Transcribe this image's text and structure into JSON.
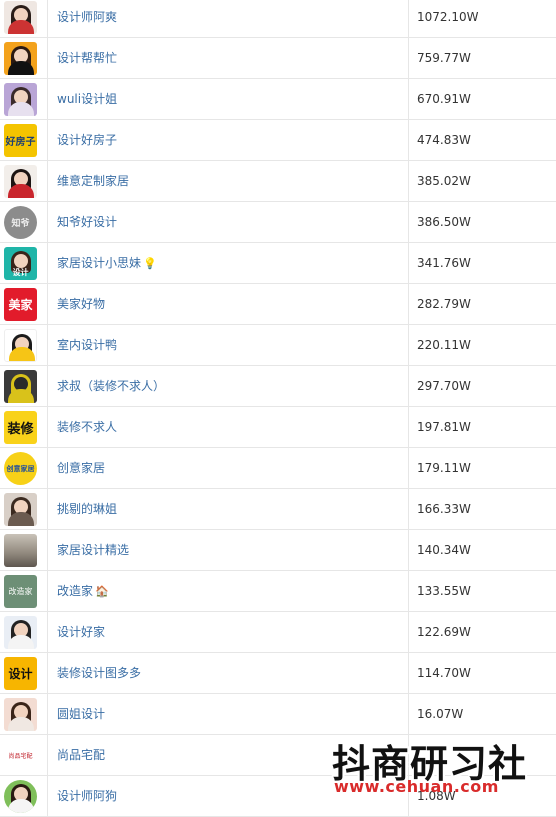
{
  "rows": [
    {
      "name": "设计师阿爽",
      "fans": "1072.10W"
    },
    {
      "name": "设计帮帮忙",
      "fans": "759.77W"
    },
    {
      "name": "wuli设计姐",
      "fans": "670.91W"
    },
    {
      "name": "设计好房子",
      "fans": "474.83W",
      "avatar_text": "好房子"
    },
    {
      "name": "维意定制家居",
      "fans": "385.02W"
    },
    {
      "name": "知爷好设计",
      "fans": "386.50W",
      "avatar_text": "知爷"
    },
    {
      "name": "家居设计小思妹",
      "fans": "341.76W",
      "emoji": "💡",
      "avatar_text": "设计"
    },
    {
      "name": "美家好物",
      "fans": "282.79W",
      "avatar_text": "美家"
    },
    {
      "name": "室内设计鸭",
      "fans": "220.11W"
    },
    {
      "name": "求叔（装修不求人）",
      "fans": "297.70W"
    },
    {
      "name": "装修不求人",
      "fans": "197.81W",
      "avatar_text": "装修"
    },
    {
      "name": "创意家居",
      "fans": "179.11W",
      "avatar_text": "创意家居"
    },
    {
      "name": "挑剔的琳姐",
      "fans": "166.33W"
    },
    {
      "name": "家居设计精选",
      "fans": "140.34W"
    },
    {
      "name": "改造家",
      "fans": "133.55W",
      "emoji": "🏠",
      "avatar_text": "改造家"
    },
    {
      "name": "设计好家",
      "fans": "122.69W"
    },
    {
      "name": "装修设计图多多",
      "fans": "114.70W",
      "avatar_text": "设计"
    },
    {
      "name": "圆姐设计",
      "fans": "16.07W"
    },
    {
      "name": "尚品宅配",
      "fans": "",
      "avatar_text": "尚品宅配"
    },
    {
      "name": "设计师阿狗",
      "fans": "1.08W"
    }
  ],
  "watermark": {
    "title": "抖商研习社",
    "url": "www.cehuan.com"
  },
  "colors": {
    "name_link": "#3a6ea5",
    "border": "#e6e6e6",
    "watermark_url": "#d92b2b"
  }
}
